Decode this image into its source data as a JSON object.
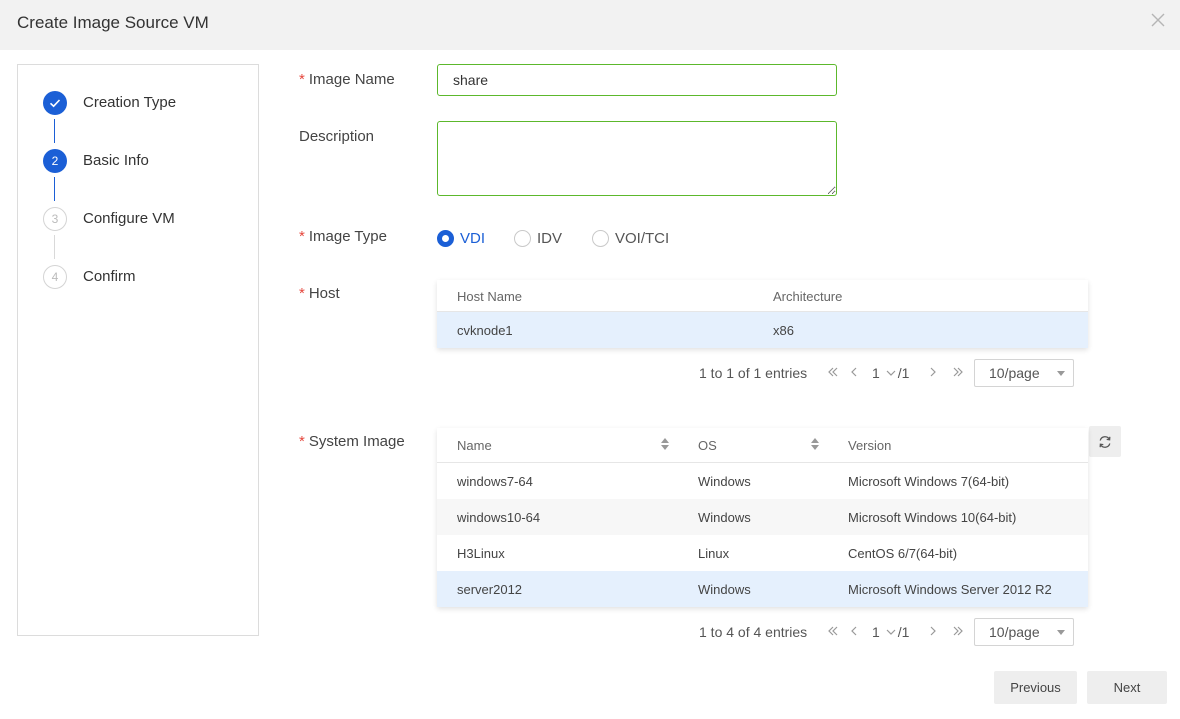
{
  "dialog": {
    "title": "Create Image Source VM"
  },
  "steps": [
    {
      "number": "1",
      "label": "Creation Type",
      "state": "done"
    },
    {
      "number": "2",
      "label": "Basic Info",
      "state": "active"
    },
    {
      "number": "3",
      "label": "Configure VM",
      "state": "pending"
    },
    {
      "number": "4",
      "label": "Confirm",
      "state": "pending"
    }
  ],
  "form": {
    "required_mark": "*",
    "image_name": {
      "label": "Image Name",
      "value": "share"
    },
    "description": {
      "label": "Description",
      "value": ""
    },
    "image_type": {
      "label": "Image Type",
      "options": [
        "VDI",
        "IDV",
        "VOI/TCI"
      ],
      "selected": "VDI"
    },
    "host": {
      "label": "Host",
      "columns": [
        "Host Name",
        "Architecture"
      ],
      "rows": [
        {
          "name": "cvknode1",
          "arch": "x86"
        }
      ],
      "pager": {
        "info": "1 to 1 of 1 entries",
        "page": "1",
        "total": "/1",
        "size": "10/page"
      }
    },
    "system_image": {
      "label": "System Image",
      "columns": [
        "Name",
        "OS",
        "Version"
      ],
      "rows": [
        {
          "name": "windows7-64",
          "os": "Windows",
          "version": "Microsoft Windows 7(64-bit)"
        },
        {
          "name": "windows10-64",
          "os": "Windows",
          "version": "Microsoft Windows 10(64-bit)"
        },
        {
          "name": "H3Linux",
          "os": "Linux",
          "version": "CentOS 6/7(64-bit)"
        },
        {
          "name": "server2012",
          "os": "Windows",
          "version": "Microsoft Windows Server 2012 R2"
        }
      ],
      "selected_row": 3,
      "pager": {
        "info": "1 to 4 of 4 entries",
        "page": "1",
        "total": "/1",
        "size": "10/page"
      }
    }
  },
  "buttons": {
    "previous": "Previous",
    "next": "Next"
  },
  "colors": {
    "accent": "#1b5fd6",
    "input_border": "#5cb82c",
    "required": "#e5463c",
    "selected_row": "#e5f0fd"
  },
  "icons": [
    "check-icon",
    "close-icon",
    "sort-icon",
    "refresh-icon",
    "first-page-icon",
    "prev-page-icon",
    "next-page-icon",
    "last-page-icon",
    "chevron-down-icon"
  ]
}
